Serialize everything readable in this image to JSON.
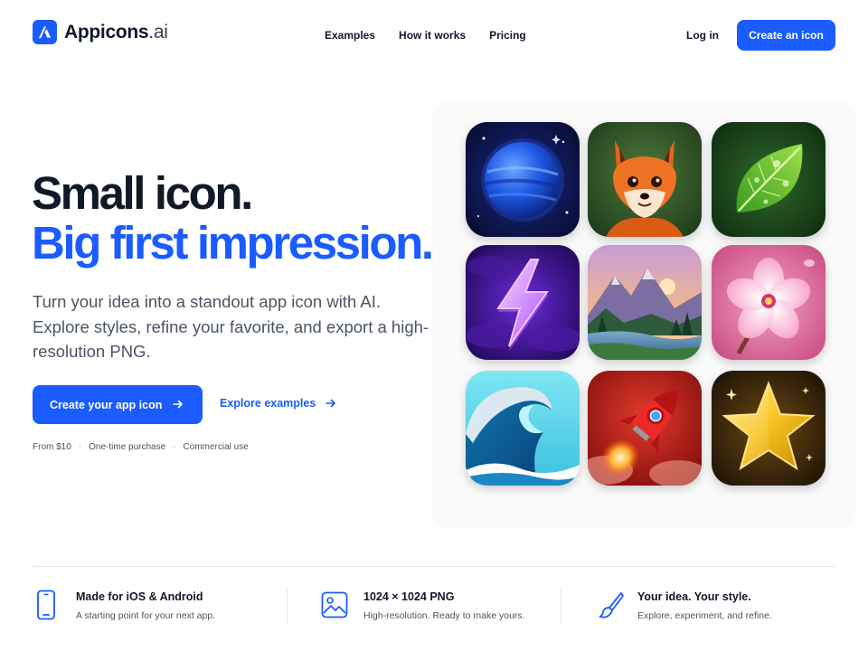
{
  "brand": {
    "name": "Appicons",
    "suffix": ".ai",
    "accent": "#1a5cff"
  },
  "nav": {
    "links": [
      "Examples",
      "How it works",
      "Pricing"
    ],
    "login": "Log in",
    "cta": "Create an icon"
  },
  "hero": {
    "title_line1": "Small icon.",
    "title_line2": "Big first impression.",
    "subtitle": "Turn your idea into a standout app icon with AI. Explore styles, refine your favorite, and export a high-resolution PNG.",
    "primary_cta": "Create your app icon",
    "secondary_cta": "Explore examples",
    "meta": [
      "From $10",
      "One-time purchase",
      "Commercial use"
    ]
  },
  "gallery": {
    "icons": [
      "planet-icon",
      "fox-icon",
      "leaf-icon",
      "lightning-icon",
      "mountain-lake-icon",
      "cherry-blossom-icon",
      "wave-icon",
      "rocket-icon",
      "star-icon"
    ]
  },
  "features": [
    {
      "icon": "phone-icon",
      "title": "Made for iOS & Android",
      "desc": "A starting point for your next app."
    },
    {
      "icon": "image-icon",
      "title": "1024 × 1024 PNG",
      "desc": "High-resolution. Ready to make yours."
    },
    {
      "icon": "brush-icon",
      "title": "Your idea. Your style.",
      "desc": "Explore, experiment, and refine."
    }
  ]
}
